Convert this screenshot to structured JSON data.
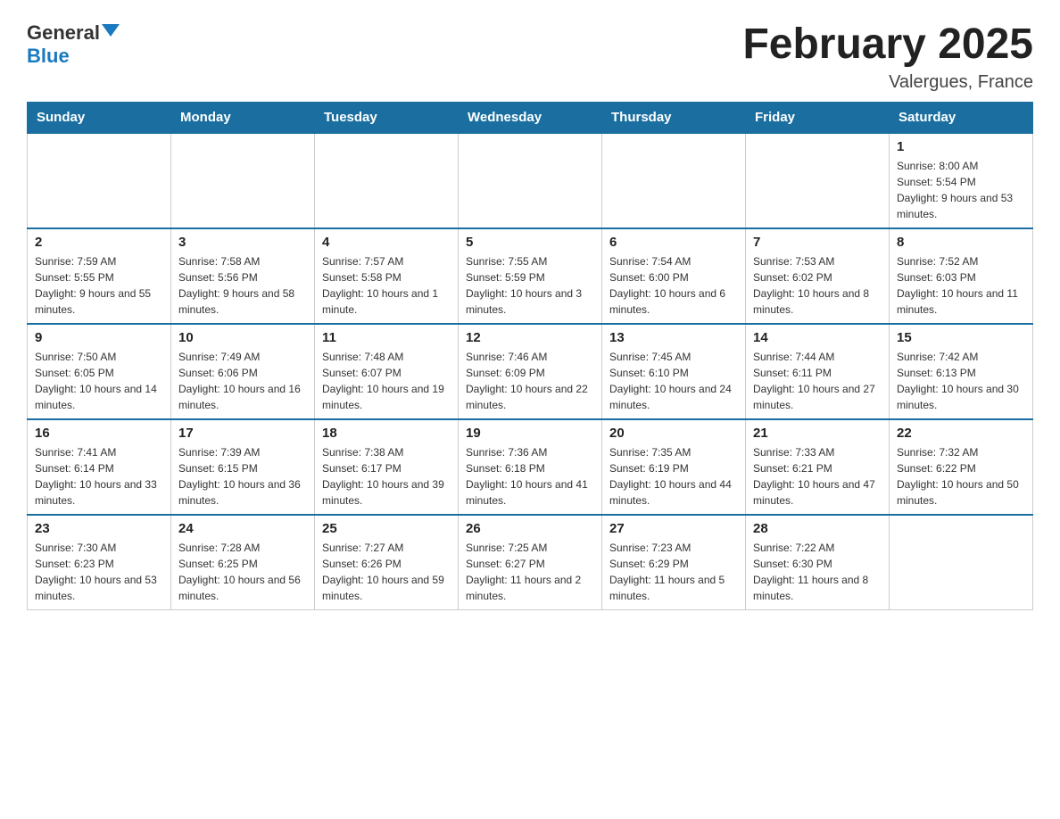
{
  "logo": {
    "general": "General",
    "blue": "Blue"
  },
  "title": "February 2025",
  "location": "Valergues, France",
  "weekdays": [
    "Sunday",
    "Monday",
    "Tuesday",
    "Wednesday",
    "Thursday",
    "Friday",
    "Saturday"
  ],
  "weeks": [
    [
      {
        "day": "",
        "info": ""
      },
      {
        "day": "",
        "info": ""
      },
      {
        "day": "",
        "info": ""
      },
      {
        "day": "",
        "info": ""
      },
      {
        "day": "",
        "info": ""
      },
      {
        "day": "",
        "info": ""
      },
      {
        "day": "1",
        "info": "Sunrise: 8:00 AM\nSunset: 5:54 PM\nDaylight: 9 hours and 53 minutes."
      }
    ],
    [
      {
        "day": "2",
        "info": "Sunrise: 7:59 AM\nSunset: 5:55 PM\nDaylight: 9 hours and 55 minutes."
      },
      {
        "day": "3",
        "info": "Sunrise: 7:58 AM\nSunset: 5:56 PM\nDaylight: 9 hours and 58 minutes."
      },
      {
        "day": "4",
        "info": "Sunrise: 7:57 AM\nSunset: 5:58 PM\nDaylight: 10 hours and 1 minute."
      },
      {
        "day": "5",
        "info": "Sunrise: 7:55 AM\nSunset: 5:59 PM\nDaylight: 10 hours and 3 minutes."
      },
      {
        "day": "6",
        "info": "Sunrise: 7:54 AM\nSunset: 6:00 PM\nDaylight: 10 hours and 6 minutes."
      },
      {
        "day": "7",
        "info": "Sunrise: 7:53 AM\nSunset: 6:02 PM\nDaylight: 10 hours and 8 minutes."
      },
      {
        "day": "8",
        "info": "Sunrise: 7:52 AM\nSunset: 6:03 PM\nDaylight: 10 hours and 11 minutes."
      }
    ],
    [
      {
        "day": "9",
        "info": "Sunrise: 7:50 AM\nSunset: 6:05 PM\nDaylight: 10 hours and 14 minutes."
      },
      {
        "day": "10",
        "info": "Sunrise: 7:49 AM\nSunset: 6:06 PM\nDaylight: 10 hours and 16 minutes."
      },
      {
        "day": "11",
        "info": "Sunrise: 7:48 AM\nSunset: 6:07 PM\nDaylight: 10 hours and 19 minutes."
      },
      {
        "day": "12",
        "info": "Sunrise: 7:46 AM\nSunset: 6:09 PM\nDaylight: 10 hours and 22 minutes."
      },
      {
        "day": "13",
        "info": "Sunrise: 7:45 AM\nSunset: 6:10 PM\nDaylight: 10 hours and 24 minutes."
      },
      {
        "day": "14",
        "info": "Sunrise: 7:44 AM\nSunset: 6:11 PM\nDaylight: 10 hours and 27 minutes."
      },
      {
        "day": "15",
        "info": "Sunrise: 7:42 AM\nSunset: 6:13 PM\nDaylight: 10 hours and 30 minutes."
      }
    ],
    [
      {
        "day": "16",
        "info": "Sunrise: 7:41 AM\nSunset: 6:14 PM\nDaylight: 10 hours and 33 minutes."
      },
      {
        "day": "17",
        "info": "Sunrise: 7:39 AM\nSunset: 6:15 PM\nDaylight: 10 hours and 36 minutes."
      },
      {
        "day": "18",
        "info": "Sunrise: 7:38 AM\nSunset: 6:17 PM\nDaylight: 10 hours and 39 minutes."
      },
      {
        "day": "19",
        "info": "Sunrise: 7:36 AM\nSunset: 6:18 PM\nDaylight: 10 hours and 41 minutes."
      },
      {
        "day": "20",
        "info": "Sunrise: 7:35 AM\nSunset: 6:19 PM\nDaylight: 10 hours and 44 minutes."
      },
      {
        "day": "21",
        "info": "Sunrise: 7:33 AM\nSunset: 6:21 PM\nDaylight: 10 hours and 47 minutes."
      },
      {
        "day": "22",
        "info": "Sunrise: 7:32 AM\nSunset: 6:22 PM\nDaylight: 10 hours and 50 minutes."
      }
    ],
    [
      {
        "day": "23",
        "info": "Sunrise: 7:30 AM\nSunset: 6:23 PM\nDaylight: 10 hours and 53 minutes."
      },
      {
        "day": "24",
        "info": "Sunrise: 7:28 AM\nSunset: 6:25 PM\nDaylight: 10 hours and 56 minutes."
      },
      {
        "day": "25",
        "info": "Sunrise: 7:27 AM\nSunset: 6:26 PM\nDaylight: 10 hours and 59 minutes."
      },
      {
        "day": "26",
        "info": "Sunrise: 7:25 AM\nSunset: 6:27 PM\nDaylight: 11 hours and 2 minutes."
      },
      {
        "day": "27",
        "info": "Sunrise: 7:23 AM\nSunset: 6:29 PM\nDaylight: 11 hours and 5 minutes."
      },
      {
        "day": "28",
        "info": "Sunrise: 7:22 AM\nSunset: 6:30 PM\nDaylight: 11 hours and 8 minutes."
      },
      {
        "day": "",
        "info": ""
      }
    ]
  ]
}
